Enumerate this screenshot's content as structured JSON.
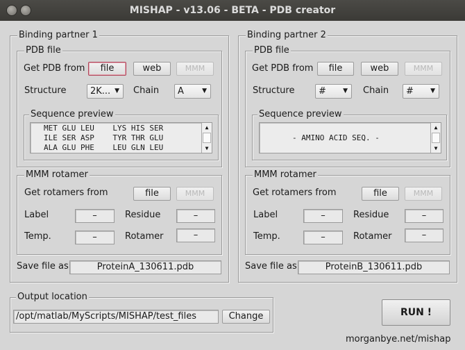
{
  "window": {
    "title": "MISHAP - v13.06 - BETA - PDB creator"
  },
  "partners": [
    {
      "title": "Binding partner 1",
      "pdb": {
        "title": "PDB file",
        "get_label": "Get PDB from",
        "file_button": "file",
        "web_button": "web",
        "mmm_button": "MMM",
        "structure_label": "Structure",
        "structure_value": "2K...",
        "chain_label": "Chain",
        "chain_value": "A",
        "sequence": {
          "title": "Sequence preview",
          "lines": [
            "MET GLU LEU    LYS HIS SER",
            "ILE SER ASP    TYR THR GLU",
            "ALA GLU PHE    LEU GLN LEU"
          ]
        }
      },
      "rotamer": {
        "title": "MMM rotamer",
        "get_label": "Get rotamers from",
        "file_button": "file",
        "mmm_button": "MMM",
        "label_label": "Label",
        "label_value": "–",
        "residue_label": "Residue",
        "residue_value": "–",
        "temp_label": "Temp.",
        "temp_value": "–",
        "rotamer_label": "Rotamer",
        "rotamer_value": "–"
      },
      "save_label": "Save file as:",
      "save_value": "ProteinA_130611.pdb"
    },
    {
      "title": "Binding partner 2",
      "pdb": {
        "title": "PDB file",
        "get_label": "Get PDB from",
        "file_button": "file",
        "web_button": "web",
        "mmm_button": "MMM",
        "structure_label": "Structure",
        "structure_value": "#",
        "chain_label": "Chain",
        "chain_value": "#",
        "sequence": {
          "title": "Sequence preview",
          "lines": [
            "- AMINO ACID SEQ. -"
          ]
        }
      },
      "rotamer": {
        "title": "MMM rotamer",
        "get_label": "Get rotamers from",
        "file_button": "file",
        "mmm_button": "MMM",
        "label_label": "Label",
        "label_value": "–",
        "residue_label": "Residue",
        "residue_value": "–",
        "temp_label": "Temp.",
        "temp_value": "–",
        "rotamer_label": "Rotamer",
        "rotamer_value": "–"
      },
      "save_label": "Save file as:",
      "save_value": "ProteinB_130611.pdb"
    }
  ],
  "output": {
    "title": "Output location",
    "path": "/opt/matlab/MyScripts/MISHAP/test_files",
    "change_button": "Change"
  },
  "run_button": "RUN !",
  "credit": "morganbye.net/mishap",
  "icons": {
    "close": "close-icon",
    "minimize": "minimize-icon",
    "dropdown": "chevron-down-icon",
    "scroll_up": "arrow-up-icon",
    "scroll_down": "arrow-down-icon"
  }
}
